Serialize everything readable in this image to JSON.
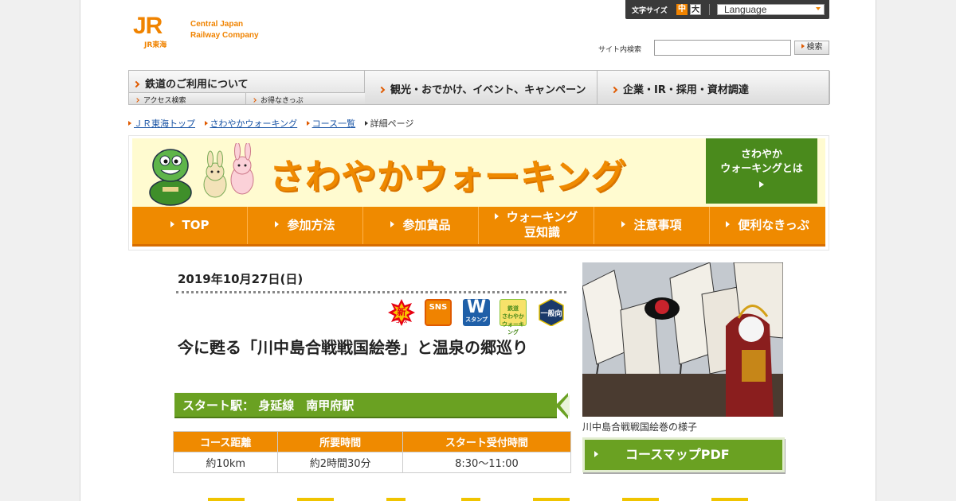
{
  "header": {
    "logo_mark": "JR",
    "logo_sub": "JR東海",
    "logo_en_1": "Central Japan",
    "logo_en_2": "Railway Company",
    "font_size_label": "文字サイズ",
    "font_size_mid": "中",
    "font_size_large": "大",
    "language": "Language",
    "search_label": "サイト内検索",
    "search_value": "",
    "search_button": "検索"
  },
  "global_nav": {
    "railway": "鉄道のご利用について",
    "access": "アクセス検索",
    "tickets": "お得なきっぷ",
    "sightseeing": "観光・おでかけ、イベント、キャンペーン",
    "corporate": "企業・IR・採用・資材調達"
  },
  "breadcrumb": [
    "ＪＲ東海トップ",
    "さわやかウォーキング",
    "コース一覧",
    "詳細ページ"
  ],
  "banner": {
    "title": "さわやかウォーキング",
    "about_1": "さわやか",
    "about_2": "ウォーキングとは",
    "nav": [
      {
        "label": "TOP"
      },
      {
        "label": "参加方法"
      },
      {
        "label": "参加賞品"
      },
      {
        "label_1": "ウォーキング",
        "label_2": "豆知識"
      },
      {
        "label": "注意事項"
      },
      {
        "label": "便利なきっぷ"
      }
    ]
  },
  "course": {
    "date": "2019年10月27日(日)",
    "badges": {
      "new": "新",
      "new_sub": "コース",
      "sns": "SNS",
      "w": "W",
      "w_sub": "スタンプ",
      "sw_1": "鉄道",
      "sw_2": "さわやか",
      "sw_3": "ウォーキング",
      "general": "一般向"
    },
    "title": "今に甦る「川中島合戦戦国絵巻」と温泉の郷巡り",
    "start": "スタート駅：  身延線　南甲府駅",
    "table_headers": [
      "コース距離",
      "所要時間",
      "スタート受付時間"
    ],
    "table_values": [
      "約10km",
      "約2時間30分",
      "8:30～11:00"
    ],
    "photo_caption": "川中島合戦戦国絵巻の様子",
    "map_button": "コースマップPDF"
  },
  "colors": {
    "orange": "#ef8a00",
    "green": "#6aa122",
    "link": "#1a55a6"
  }
}
